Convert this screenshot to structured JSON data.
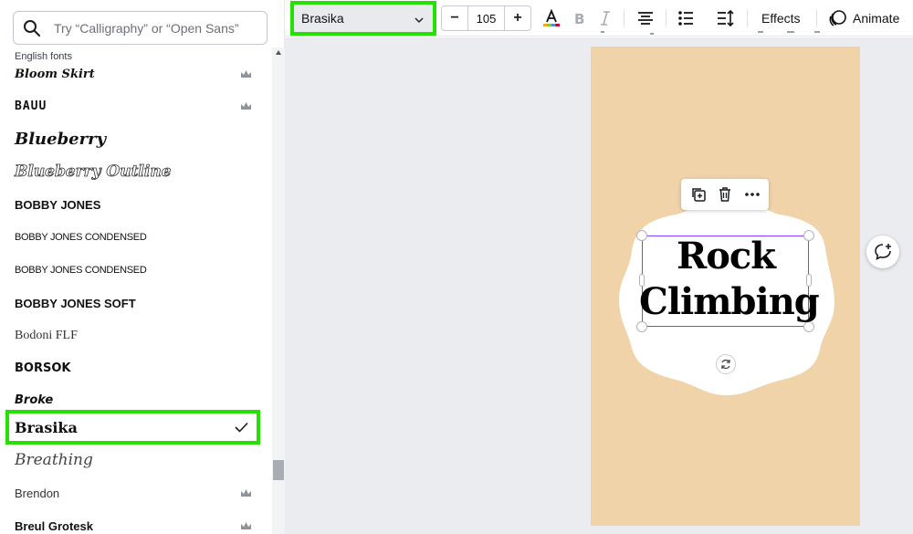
{
  "search": {
    "placeholder": "Try “Calligraphy” or “Open Sans”"
  },
  "panel": {
    "section_label": "English fonts"
  },
  "fonts": [
    {
      "name": "Bloom Skirt",
      "premium": true
    },
    {
      "name": "BAUU",
      "premium": true
    },
    {
      "name": "Blueberry",
      "premium": false
    },
    {
      "name": "Blueberry Outline",
      "premium": false
    },
    {
      "name": "BOBBY JONES",
      "premium": false
    },
    {
      "name": "BOBBY JONES CONDENSED",
      "premium": false
    },
    {
      "name": "BOBBY JONES CONDENSED",
      "premium": false
    },
    {
      "name": "BOBBY JONES SOFT",
      "premium": false
    },
    {
      "name": "Bodoni FLF",
      "premium": false
    },
    {
      "name": "BORSOK",
      "premium": false
    },
    {
      "name": "Broke",
      "premium": false
    },
    {
      "name": "Brasika",
      "premium": false,
      "selected": true
    },
    {
      "name": "Breathing",
      "premium": false
    },
    {
      "name": "Brendon",
      "premium": true
    },
    {
      "name": "Breul Grotesk",
      "premium": true
    }
  ],
  "toolbar": {
    "font_family": "Brasika",
    "font_size": "105",
    "minus": "−",
    "plus": "+",
    "effects_label": "Effects",
    "animate_label": "Animate",
    "text_color": "#000000"
  },
  "canvas": {
    "headline_line1": "Rock",
    "headline_line2": "Climbing",
    "page_color": "#f1d3aa",
    "accent_color": "#8b3dff",
    "highlight_color": "#25e000"
  }
}
